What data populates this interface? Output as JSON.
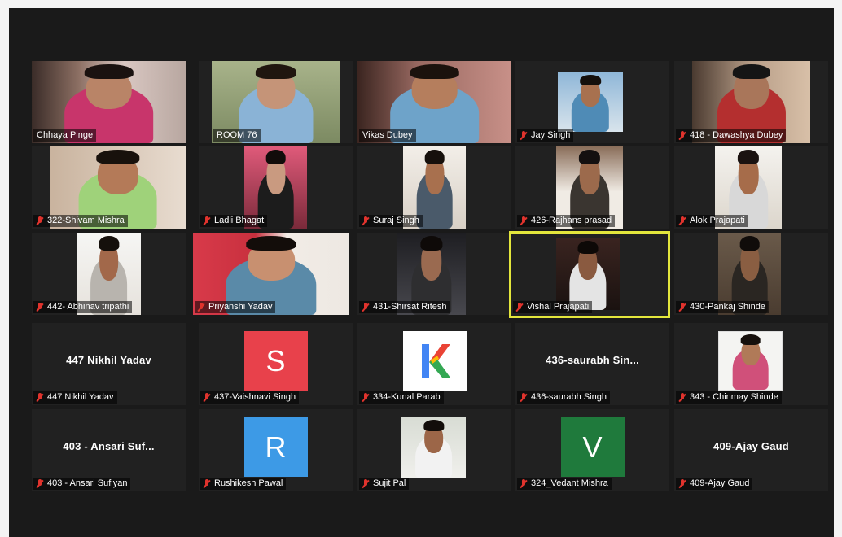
{
  "participants": [
    {
      "label": "Chhaya Pinge",
      "muted": false
    },
    {
      "label": "ROOM 76",
      "muted": false
    },
    {
      "label": "Vikas Dubey",
      "muted": false
    },
    {
      "label": "Jay Singh",
      "muted": true
    },
    {
      "label": "418 - Dawashya Dubey",
      "muted": true
    },
    {
      "label": "322-Shivam Mishra",
      "muted": true
    },
    {
      "label": "Ladli Bhagat",
      "muted": true
    },
    {
      "label": "Suraj Singh",
      "muted": true
    },
    {
      "label": "426-Rajhans prasad",
      "muted": true
    },
    {
      "label": "Alok Prajapati",
      "muted": true
    },
    {
      "label": "442- Abhinav tripathi",
      "muted": true
    },
    {
      "label": "Priyanshi Yadav",
      "muted": true
    },
    {
      "label": "431-Shirsat Ritesh",
      "muted": true
    },
    {
      "label": "Vishal Prajapati",
      "muted": true,
      "active": true
    },
    {
      "label": "430-Pankaj Shinde",
      "muted": true
    },
    {
      "label": "447 Nikhil Yadav",
      "muted": true,
      "display_name": "447 Nikhil Yadav"
    },
    {
      "label": "437-Vaishnavi Singh",
      "muted": true,
      "avatar_letter": "S",
      "avatar_color": "#e8414b"
    },
    {
      "label": "334-Kunal Parab",
      "muted": true,
      "avatar_letter": "K"
    },
    {
      "label": "436-saurabh Singh",
      "muted": true,
      "display_name": "436-saurabh  Sin..."
    },
    {
      "label": "343 - Chinmay Shinde",
      "muted": true
    },
    {
      "label": "403 - Ansari Sufiyan",
      "muted": true,
      "display_name": "403 - Ansari Suf..."
    },
    {
      "label": "Rushikesh Pawal",
      "muted": true,
      "avatar_letter": "R",
      "avatar_color": "#3d9ae6"
    },
    {
      "label": "Sujit Pal",
      "muted": true
    },
    {
      "label": "324_Vedant Mishra",
      "muted": true,
      "avatar_letter": "V",
      "avatar_color": "#1f7a3c"
    },
    {
      "label": "409-Ajay Gaud",
      "muted": true,
      "display_name": "409-Ajay Gaud"
    }
  ]
}
